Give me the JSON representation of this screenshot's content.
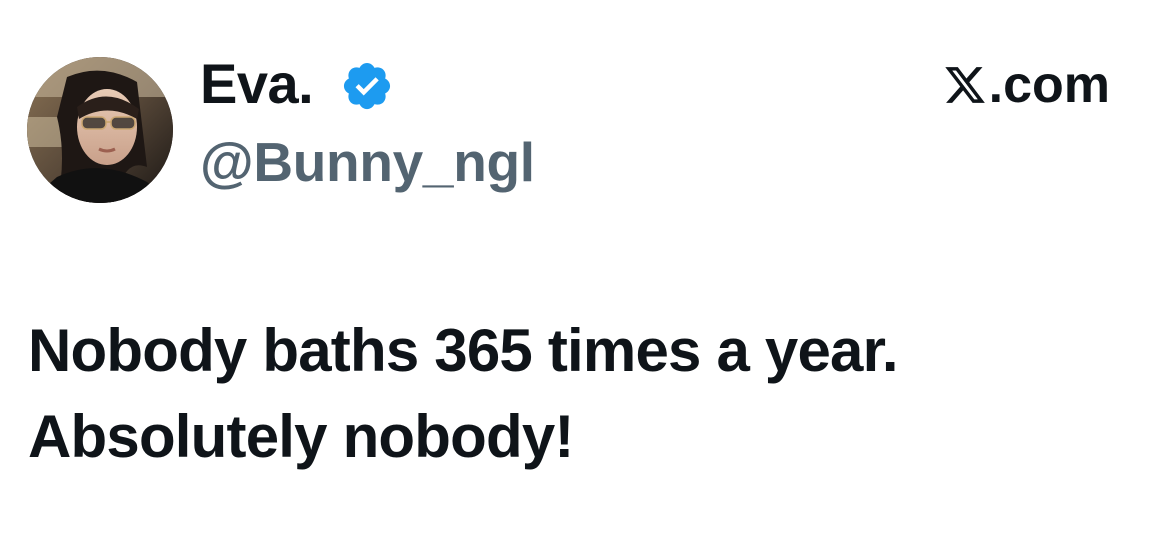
{
  "author": {
    "display_name": "Eva.",
    "handle": "@Bunny_ngl",
    "verified": true,
    "verified_color": "#1d9bf0",
    "avatar_icon": "profile-photo"
  },
  "brand": {
    "icon": "x-logo-icon",
    "suffix": ".com"
  },
  "tweet": {
    "lines": [
      "Nobody baths 365 times a year.",
      "Absolutely nobody!"
    ]
  },
  "colors": {
    "text_primary": "#0f1419",
    "text_secondary": "#536471",
    "background": "#ffffff"
  }
}
